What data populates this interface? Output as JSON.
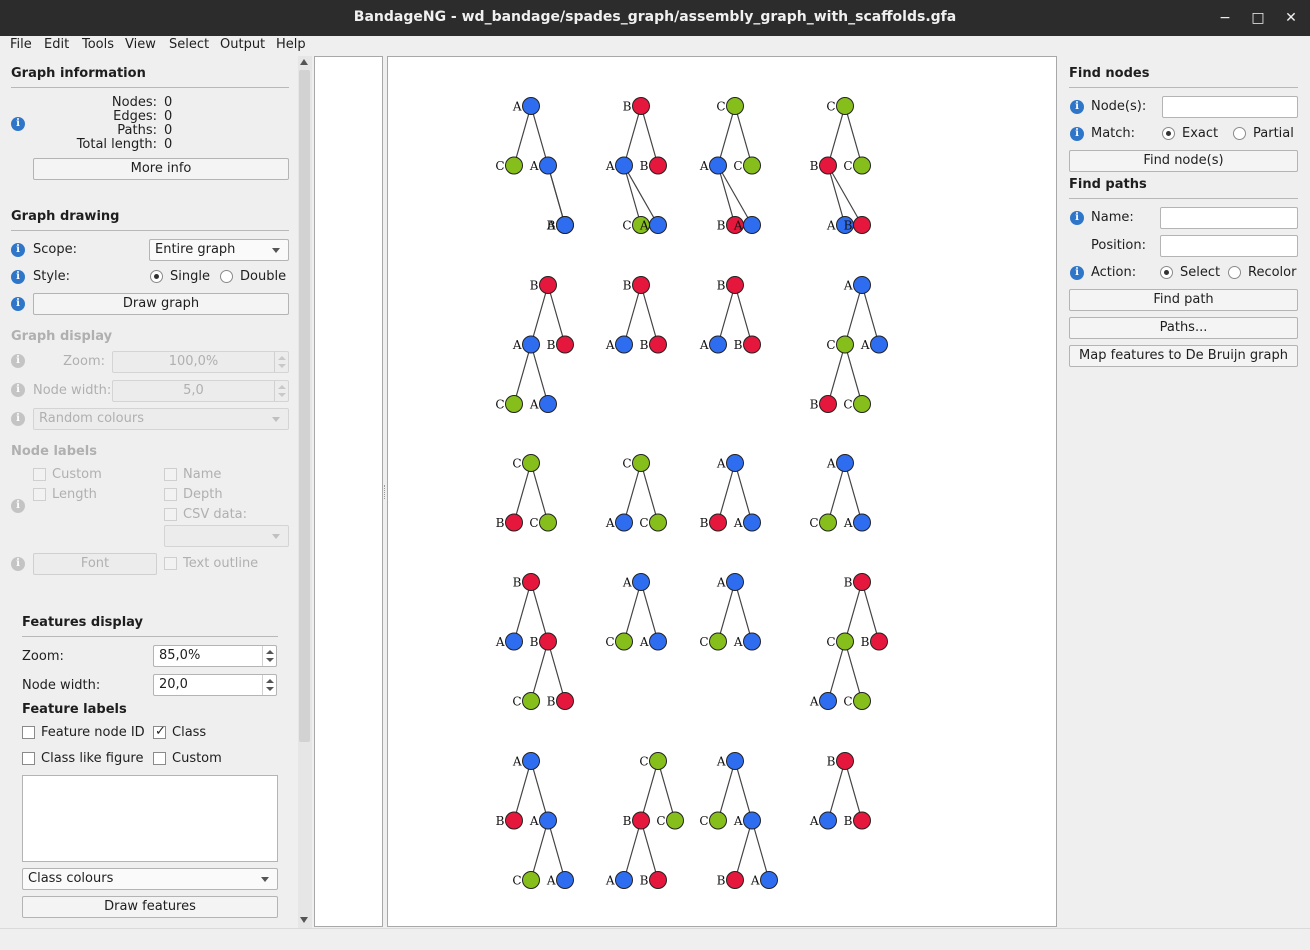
{
  "window": {
    "title": "BandageNG - wd_bandage/spades_graph/assembly_graph_with_scaffolds.gfa",
    "minimize": "−",
    "maximize": "□",
    "close": "✕"
  },
  "menu": [
    "File",
    "Edit",
    "Tools",
    "View",
    "Select",
    "Output",
    "Help"
  ],
  "graph_info": {
    "title": "Graph information",
    "nodes_label": "Nodes:",
    "nodes_value": "0",
    "edges_label": "Edges:",
    "edges_value": "0",
    "paths_label": "Paths:",
    "paths_value": "0",
    "length_label": "Total length:",
    "length_value": "0",
    "more_info": "More info"
  },
  "graph_drawing": {
    "title": "Graph drawing",
    "scope_label": "Scope:",
    "scope_value": "Entire graph",
    "style_label": "Style:",
    "style_single": "Single",
    "style_double": "Double",
    "draw_button": "Draw graph"
  },
  "graph_display": {
    "title": "Graph display",
    "zoom_label": "Zoom:",
    "zoom_value": "100,0%",
    "node_width_label": "Node width:",
    "node_width_value": "5,0",
    "colour_value": "Random colours"
  },
  "node_labels": {
    "title": "Node labels",
    "custom": "Custom",
    "name": "Name",
    "length": "Length",
    "depth": "Depth",
    "csv": "CSV data:",
    "font": "Font",
    "text_outline": "Text outline"
  },
  "features_display": {
    "title": "Features display",
    "zoom_label": "Zoom:",
    "zoom_value": "85,0%",
    "node_width_label": "Node width:",
    "node_width_value": "20,0",
    "labels_title": "Feature labels",
    "feature_node_id": "Feature node ID",
    "class": "Class",
    "class_like_figure": "Class like figure",
    "custom": "Custom",
    "colours_value": "Class colours",
    "draw_button": "Draw features"
  },
  "find_nodes": {
    "title": "Find nodes",
    "nodes_label": "Node(s):",
    "match_label": "Match:",
    "exact": "Exact",
    "partial": "Partial",
    "find_button": "Find node(s)"
  },
  "find_paths": {
    "title": "Find paths",
    "name_label": "Name:",
    "position_label": "Position:",
    "action_label": "Action:",
    "select": "Select",
    "recolor": "Recolor",
    "find_button": "Find path",
    "paths_button": "Paths...",
    "map_button": "Map features to De Bruijn graph"
  },
  "colors": {
    "A": "#2f6df0",
    "B": "#e5173d",
    "C": "#86bf1c",
    "edge": "#444444"
  },
  "trees": [
    {
      "nodes": [
        [
          "A",
          1
        ],
        [
          "C",
          0
        ],
        [
          "A",
          2
        ],
        [
          "B",
          3
        ],
        [
          "A",
          3
        ]
      ],
      "edges": [
        [
          0,
          1
        ],
        [
          0,
          2
        ],
        [
          2,
          3
        ],
        [
          2,
          4
        ]
      ]
    },
    {
      "nodes": [
        [
          "B",
          1
        ],
        [
          "A",
          0
        ],
        [
          "B",
          2
        ],
        [
          "C",
          1
        ],
        [
          "A",
          2
        ]
      ],
      "edges": [
        [
          0,
          1
        ],
        [
          0,
          2
        ],
        [
          1,
          3
        ],
        [
          1,
          4
        ]
      ]
    },
    {
      "nodes": [
        [
          "C",
          1
        ],
        [
          "A",
          0
        ],
        [
          "C",
          2
        ],
        [
          "B",
          1
        ],
        [
          "A",
          2
        ]
      ],
      "edges": [
        [
          0,
          1
        ],
        [
          0,
          2
        ],
        [
          1,
          3
        ],
        [
          1,
          4
        ]
      ]
    },
    {
      "nodes": [
        [
          "C",
          1
        ],
        [
          "B",
          0
        ],
        [
          "C",
          2
        ],
        [
          "A",
          1
        ],
        [
          "B",
          2
        ]
      ],
      "edges": [
        [
          0,
          1
        ],
        [
          0,
          2
        ],
        [
          1,
          3
        ],
        [
          1,
          4
        ]
      ]
    },
    {
      "nodes": [
        [
          "B",
          2
        ],
        [
          "A",
          1
        ],
        [
          "B",
          3
        ],
        [
          "C",
          0
        ],
        [
          "A",
          2
        ]
      ],
      "edges": [
        [
          0,
          1
        ],
        [
          0,
          2
        ],
        [
          1,
          3
        ],
        [
          1,
          4
        ]
      ]
    },
    {
      "nodes": [
        [
          "B",
          1
        ],
        [
          "A",
          0
        ],
        [
          "B",
          2
        ]
      ],
      "edges": [
        [
          0,
          1
        ],
        [
          0,
          2
        ]
      ]
    },
    {
      "nodes": [
        [
          "B",
          1
        ],
        [
          "A",
          0
        ],
        [
          "B",
          2
        ]
      ],
      "edges": [
        [
          0,
          1
        ],
        [
          0,
          2
        ]
      ]
    },
    {
      "nodes": [
        [
          "A",
          2
        ],
        [
          "C",
          1
        ],
        [
          "A",
          3
        ],
        [
          "B",
          0
        ],
        [
          "C",
          2
        ]
      ],
      "edges": [
        [
          0,
          1
        ],
        [
          0,
          2
        ],
        [
          1,
          3
        ],
        [
          1,
          4
        ]
      ]
    },
    {
      "nodes": [
        [
          "C",
          1
        ],
        [
          "B",
          0
        ],
        [
          "C",
          2
        ]
      ],
      "edges": [
        [
          0,
          1
        ],
        [
          0,
          2
        ]
      ]
    },
    {
      "nodes": [
        [
          "C",
          1
        ],
        [
          "A",
          0
        ],
        [
          "C",
          2
        ]
      ],
      "edges": [
        [
          0,
          1
        ],
        [
          0,
          2
        ]
      ]
    },
    {
      "nodes": [
        [
          "A",
          1
        ],
        [
          "B",
          0
        ],
        [
          "A",
          2
        ]
      ],
      "edges": [
        [
          0,
          1
        ],
        [
          0,
          2
        ]
      ]
    },
    {
      "nodes": [
        [
          "A",
          1
        ],
        [
          "C",
          0
        ],
        [
          "A",
          2
        ]
      ],
      "edges": [
        [
          0,
          1
        ],
        [
          0,
          2
        ]
      ]
    },
    {
      "nodes": [
        [
          "B",
          1
        ],
        [
          "A",
          0
        ],
        [
          "B",
          2
        ],
        [
          "C",
          1
        ],
        [
          "B",
          3
        ]
      ],
      "edges": [
        [
          0,
          1
        ],
        [
          0,
          2
        ],
        [
          2,
          3
        ],
        [
          2,
          4
        ]
      ]
    },
    {
      "nodes": [
        [
          "A",
          1
        ],
        [
          "C",
          0
        ],
        [
          "A",
          2
        ]
      ],
      "edges": [
        [
          0,
          1
        ],
        [
          0,
          2
        ]
      ]
    },
    {
      "nodes": [
        [
          "A",
          1
        ],
        [
          "C",
          0
        ],
        [
          "A",
          2
        ]
      ],
      "edges": [
        [
          0,
          1
        ],
        [
          0,
          2
        ]
      ]
    },
    {
      "nodes": [
        [
          "B",
          2
        ],
        [
          "C",
          1
        ],
        [
          "B",
          3
        ],
        [
          "A",
          0
        ],
        [
          "C",
          2
        ]
      ],
      "edges": [
        [
          0,
          1
        ],
        [
          0,
          2
        ],
        [
          1,
          3
        ],
        [
          1,
          4
        ]
      ]
    },
    {
      "nodes": [
        [
          "A",
          1
        ],
        [
          "B",
          0
        ],
        [
          "A",
          2
        ],
        [
          "C",
          1
        ],
        [
          "A",
          3
        ]
      ],
      "edges": [
        [
          0,
          1
        ],
        [
          0,
          2
        ],
        [
          2,
          3
        ],
        [
          2,
          4
        ]
      ]
    },
    {
      "nodes": [
        [
          "C",
          2
        ],
        [
          "B",
          1
        ],
        [
          "C",
          3
        ],
        [
          "A",
          0
        ],
        [
          "B",
          2
        ]
      ],
      "edges": [
        [
          0,
          1
        ],
        [
          0,
          2
        ],
        [
          1,
          3
        ],
        [
          1,
          4
        ]
      ]
    },
    {
      "nodes": [
        [
          "A",
          1
        ],
        [
          "C",
          0
        ],
        [
          "A",
          2
        ],
        [
          "B",
          1
        ],
        [
          "A",
          3
        ]
      ],
      "edges": [
        [
          0,
          1
        ],
        [
          0,
          2
        ],
        [
          2,
          3
        ],
        [
          2,
          4
        ]
      ]
    },
    {
      "nodes": [
        [
          "B",
          1
        ],
        [
          "A",
          0
        ],
        [
          "B",
          2
        ]
      ],
      "edges": [
        [
          0,
          1
        ],
        [
          0,
          2
        ]
      ]
    }
  ]
}
